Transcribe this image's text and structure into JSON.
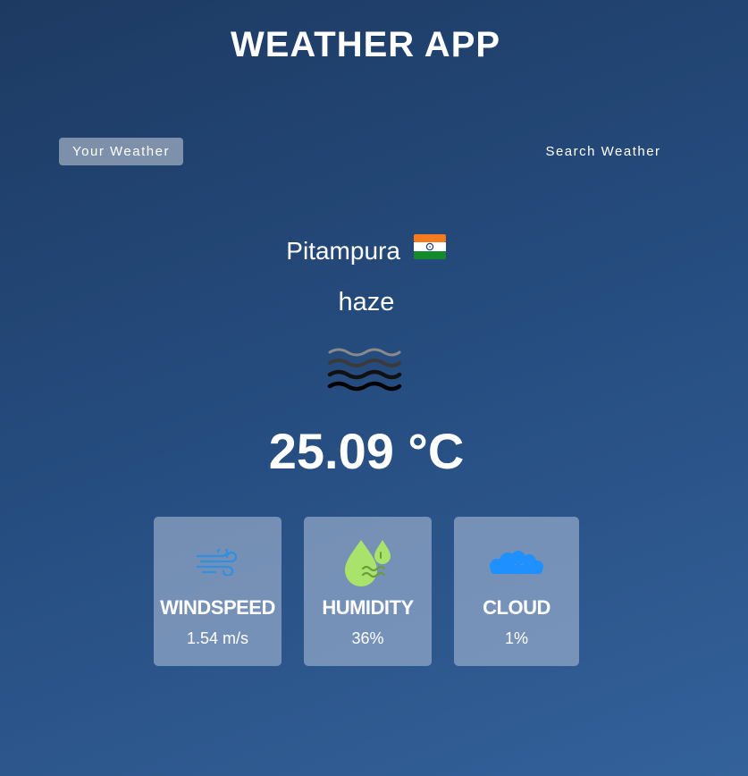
{
  "app": {
    "title": "WEATHER APP"
  },
  "tabs": [
    {
      "label": "Your Weather",
      "active": true
    },
    {
      "label": "Search Weather",
      "active": false
    }
  ],
  "weather": {
    "city": "Pitampura",
    "country_flag_icon": "india-flag-icon",
    "condition": "haze",
    "condition_icon": "haze-icon",
    "temperature": "25.09 °C"
  },
  "metrics": [
    {
      "label": "WINDSPEED",
      "value": "1.54 m/s",
      "icon": "wind-icon"
    },
    {
      "label": "HUMIDITY",
      "value": "36%",
      "icon": "humidity-icon"
    },
    {
      "label": "CLOUD",
      "value": "1%",
      "icon": "cloud-icon"
    }
  ],
  "colors": {
    "background_top": "#1d3a62",
    "background_bottom": "#33619a",
    "card_bg": "#8a9fc0",
    "wind_icon": "#2f8fe0",
    "humidity_icon": "#a9e36b",
    "cloud_icon": "#1e90ff"
  }
}
